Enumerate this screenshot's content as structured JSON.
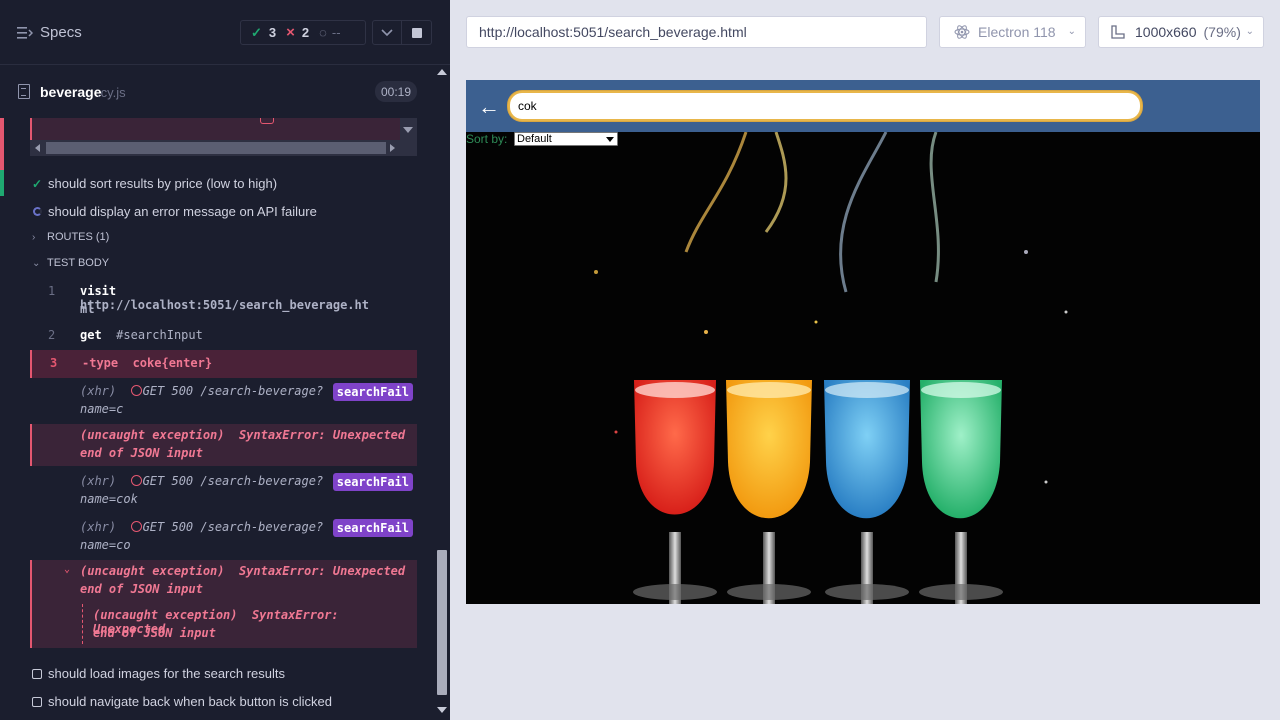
{
  "reporter": {
    "specs_label": "Specs",
    "stats": {
      "passed": "3",
      "failed": "2",
      "pending": "--"
    },
    "file": {
      "name": "beverage",
      "ext": ".cy.js",
      "timer": "00:19"
    },
    "tests": [
      {
        "title": "should sort results by price (low to high)",
        "state": "passed"
      },
      {
        "title": "should display an error message on API failure",
        "state": "running"
      },
      {
        "title": "should load images for the search results",
        "state": "pending"
      },
      {
        "title": "should navigate back when back button is clicked",
        "state": "pending"
      }
    ],
    "sections": {
      "routes": "ROUTES (1)",
      "test_body": "TEST BODY"
    },
    "commands": [
      {
        "num": "1",
        "name": "visit",
        "arg_line1": "http://localhost:5051/search_beverage.ht",
        "arg_line2": "ml"
      },
      {
        "num": "2",
        "name": "get",
        "arg": "#searchInput"
      },
      {
        "num": "3",
        "name": "-type",
        "arg": "coke{enter}"
      }
    ],
    "log": {
      "xhr_label": "(xhr)",
      "xhr_req": "GET 500 /search-beverage?",
      "alias": "searchFail",
      "xhr1_query": "name=c",
      "xhr2_query": "name=cok",
      "xhr3_query": "name=co",
      "exc_label": "(uncaught exception)",
      "exc_msg1": "SyntaxError: Unexpected",
      "exc_msg2": "end of JSON input"
    }
  },
  "browser": {
    "url": "http://localhost:5051/search_beverage.html",
    "browser_name": "Electron 118",
    "viewport": "1000x660",
    "zoom": "(79%)"
  },
  "app": {
    "back_arrow": "←",
    "search_value": "cok",
    "sort_label": "Sort by:",
    "sort_selected": "Default"
  },
  "colors": {
    "passed": "#1fa971",
    "failed": "#e45770",
    "alias": "#7f43c9",
    "app_header": "#3c6090",
    "search_border": "#e8b64a"
  }
}
